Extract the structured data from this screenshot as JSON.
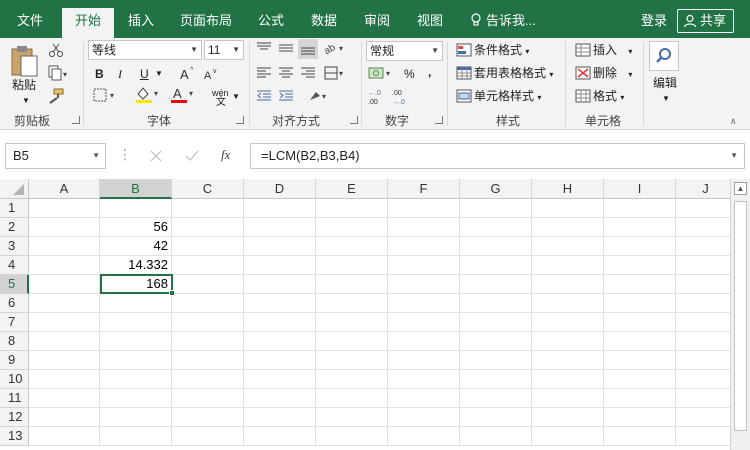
{
  "tabs": [
    {
      "label": "文件",
      "active": false
    },
    {
      "label": "开始",
      "active": true
    },
    {
      "label": "插入",
      "active": false
    },
    {
      "label": "页面布局",
      "active": false
    },
    {
      "label": "公式",
      "active": false
    },
    {
      "label": "数据",
      "active": false
    },
    {
      "label": "审阅",
      "active": false
    },
    {
      "label": "视图",
      "active": false
    }
  ],
  "tell_me": "告诉我...",
  "login": "登录",
  "share": "共享",
  "ribbon": {
    "clipboard": {
      "paste": "粘贴",
      "label": "剪贴板"
    },
    "font": {
      "name": "等线",
      "size": "11",
      "label": "字体",
      "bold": "B",
      "italic": "I",
      "underline": "U",
      "phonetic": "wén"
    },
    "alignment": {
      "label": "对齐方式"
    },
    "number": {
      "format": "常规",
      "percent": "%",
      "comma": ",",
      "label": "数字"
    },
    "styles": {
      "conditional": "条件格式",
      "table": "套用表格格式",
      "cell": "单元格样式",
      "label": "样式"
    },
    "cells": {
      "insert": "插入",
      "delete": "删除",
      "format": "格式",
      "label": "单元格"
    },
    "editing": {
      "label": "编辑"
    }
  },
  "formula_bar": {
    "name_box": "B5",
    "fx": "fx",
    "formula": "=LCM(B2,B3,B4)"
  },
  "columns": [
    "A",
    "B",
    "C",
    "D",
    "E",
    "F",
    "G",
    "H",
    "I",
    "J"
  ],
  "rows": [
    "1",
    "2",
    "3",
    "4",
    "5",
    "6",
    "7",
    "8",
    "9",
    "10",
    "11",
    "12",
    "13"
  ],
  "cells": {
    "B2": "56",
    "B3": "42",
    "B4": "14.332",
    "B5": "168"
  },
  "colors": {
    "accent": "#217346",
    "ribbon": "#f3f3f3"
  }
}
